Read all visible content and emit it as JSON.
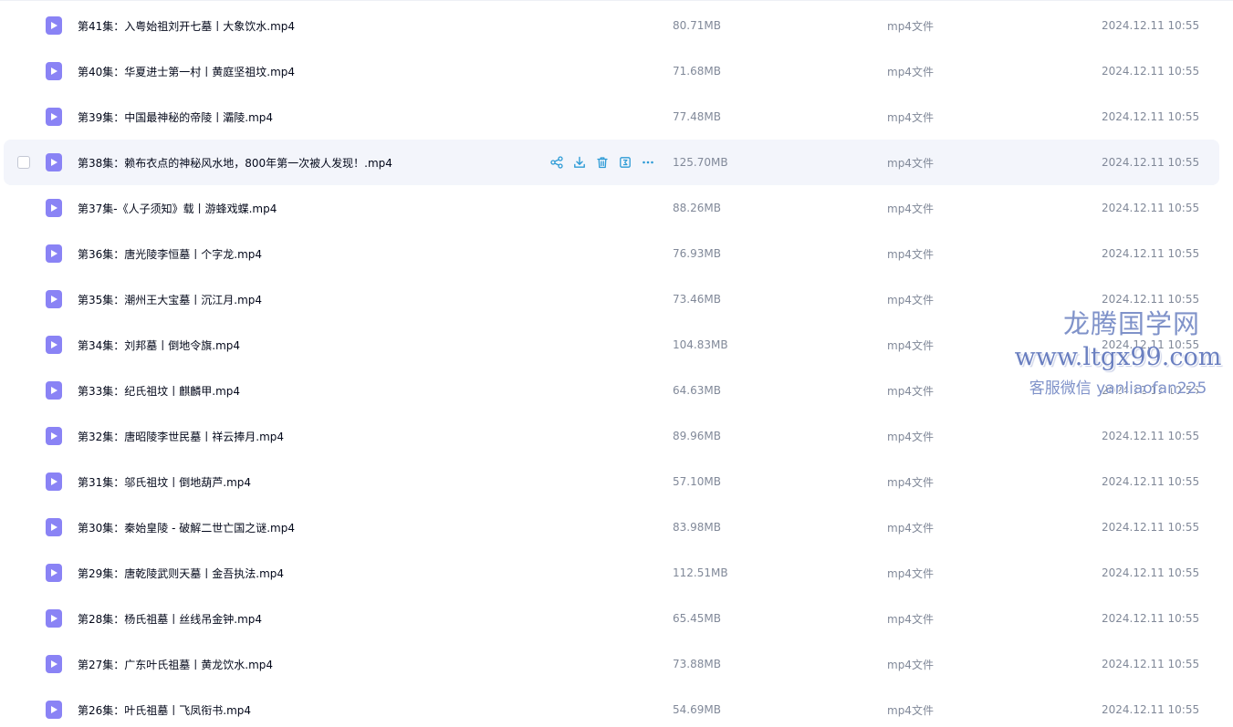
{
  "files": [
    {
      "name": "第41集：入粤始祖刘开七墓丨大象饮水.mp4",
      "size": "80.71MB",
      "type": "mp4文件",
      "date": "2024.12.11 10:55"
    },
    {
      "name": "第40集：华夏进士第一村丨黄庭坚祖坟.mp4",
      "size": "71.68MB",
      "type": "mp4文件",
      "date": "2024.12.11 10:55"
    },
    {
      "name": "第39集：中国最神秘的帝陵丨灞陵.mp4",
      "size": "77.48MB",
      "type": "mp4文件",
      "date": "2024.12.11 10:55"
    },
    {
      "name": "第38集：赖布衣点的神秘风水地，800年第一次被人发现！.mp4",
      "size": "125.70MB",
      "type": "mp4文件",
      "date": "2024.12.11 10:55"
    },
    {
      "name": "第37集-《人子须知》载丨游蜂戏蝶.mp4",
      "size": "88.26MB",
      "type": "mp4文件",
      "date": "2024.12.11 10:55"
    },
    {
      "name": "第36集：唐光陵李恒墓丨个字龙.mp4",
      "size": "76.93MB",
      "type": "mp4文件",
      "date": "2024.12.11 10:55"
    },
    {
      "name": "第35集：潮州王大宝墓丨沉江月.mp4",
      "size": "73.46MB",
      "type": "mp4文件",
      "date": "2024.12.11 10:55"
    },
    {
      "name": "第34集：刘邦墓丨倒地令旗.mp4",
      "size": "104.83MB",
      "type": "mp4文件",
      "date": "2024.12.11 10:55"
    },
    {
      "name": "第33集：纪氏祖坟丨麒麟甲.mp4",
      "size": "64.63MB",
      "type": "mp4文件",
      "date": "2024.12.11 10:55"
    },
    {
      "name": "第32集：唐昭陵李世民墓丨祥云捧月.mp4",
      "size": "89.96MB",
      "type": "mp4文件",
      "date": "2024.12.11 10:55"
    },
    {
      "name": "第31集：邬氏祖坟丨倒地葫芦.mp4",
      "size": "57.10MB",
      "type": "mp4文件",
      "date": "2024.12.11 10:55"
    },
    {
      "name": "第30集：秦始皇陵 - 破解二世亡国之谜.mp4",
      "size": "83.98MB",
      "type": "mp4文件",
      "date": "2024.12.11 10:55"
    },
    {
      "name": "第29集：唐乾陵武则天墓丨金吾执法.mp4",
      "size": "112.51MB",
      "type": "mp4文件",
      "date": "2024.12.11 10:55"
    },
    {
      "name": "第28集：杨氏祖墓丨丝线吊金钟.mp4",
      "size": "65.45MB",
      "type": "mp4文件",
      "date": "2024.12.11 10:55"
    },
    {
      "name": "第27集：广东叶氏祖墓丨黄龙饮水.mp4",
      "size": "73.88MB",
      "type": "mp4文件",
      "date": "2024.12.11 10:55"
    },
    {
      "name": "第26集：叶氏祖墓丨飞凤衔书.mp4",
      "size": "54.69MB",
      "type": "mp4文件",
      "date": "2024.12.11 10:55"
    }
  ],
  "hovered_index": 3,
  "row_actions": [
    {
      "icon": "share-icon"
    },
    {
      "icon": "download-icon"
    },
    {
      "icon": "delete-icon"
    },
    {
      "icon": "summary-icon"
    },
    {
      "icon": "more-icon"
    }
  ],
  "watermark": {
    "title": "龙腾国学网",
    "url": "www.ltgx99.com",
    "contact": "客服微信 yanliaofan225"
  },
  "colors": {
    "video_icon": "#8a83f5",
    "action_icon": "#2d9bd6",
    "hover_bg": "#f3f5fb",
    "meta_text": "#818999",
    "watermark": "#7f92c9"
  }
}
